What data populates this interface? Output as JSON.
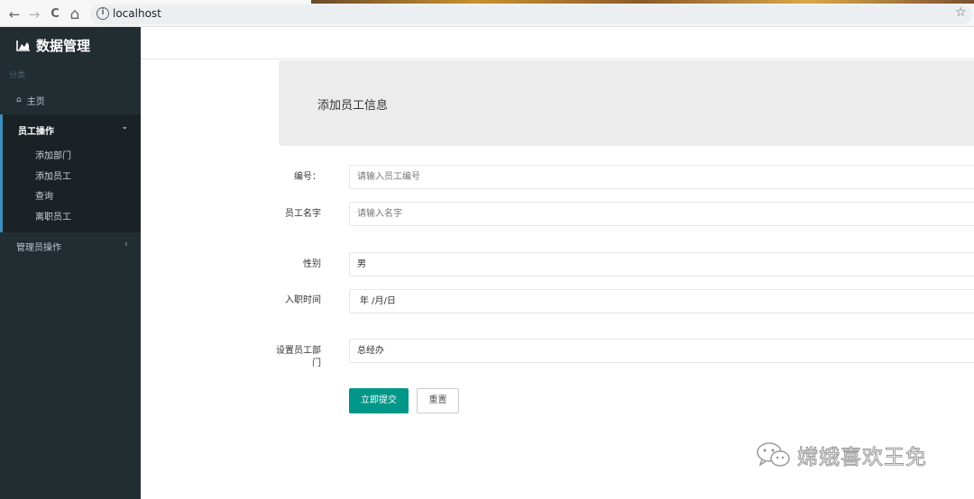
{
  "browser": {
    "url": "localhost",
    "back_icon": "←",
    "forward_icon": "→",
    "reload_icon": "C",
    "home_icon": "⌂",
    "info_icon": "i",
    "star_icon": "☆"
  },
  "sidebar": {
    "brand": "数据管理",
    "category": "分类",
    "home": "主页",
    "employee_group": {
      "title": "员工操作",
      "items": [
        "添加部门",
        "添加员工",
        "查询",
        "离职员工"
      ]
    },
    "admin_group": "管理员操作"
  },
  "main": {
    "panel_title": "添加员工信息",
    "fields": {
      "id": {
        "label": "编号：",
        "placeholder": "请输入员工编号"
      },
      "name": {
        "label": "员工名字",
        "placeholder": "请输入名字"
      },
      "gender": {
        "label": "性别",
        "value": "男"
      },
      "hire_date": {
        "label": "入职时间",
        "value": "年 /月/日"
      },
      "department": {
        "label": "设置员工部门",
        "value": "总经办"
      }
    },
    "submit": "立即提交",
    "reset": "重置"
  },
  "watermark": {
    "text": "嫦娥喜欢王免"
  },
  "colors": {
    "sidebar_bg": "#222d32",
    "accent": "#009688",
    "active_border": "#3c8dbc"
  }
}
